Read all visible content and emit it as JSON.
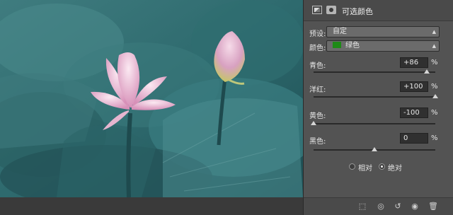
{
  "panel": {
    "title": "可选颜色",
    "preset": {
      "label": "预设:",
      "value": "自定"
    },
    "colors": {
      "label": "颜色:",
      "value": "绿色",
      "swatch": "#1e8a16"
    },
    "sliders": [
      {
        "label": "青色:",
        "value": "+86",
        "unit": "%",
        "fraction": 0.93
      },
      {
        "label": "洋红:",
        "value": "+100",
        "unit": "%",
        "fraction": 1.0
      },
      {
        "label": "黄色:",
        "value": "-100",
        "unit": "%",
        "fraction": 0.0
      },
      {
        "label": "黑色:",
        "value": "0",
        "unit": "%",
        "fraction": 0.5
      }
    ],
    "method": {
      "relative": "相对",
      "absolute": "绝对",
      "selected": "absolute"
    }
  },
  "icons": {
    "header": [
      "adjustment-icon",
      "mask-icon"
    ],
    "footer": [
      "clip-to-layer-icon",
      "view-previous-icon",
      "reset-icon",
      "visibility-eye-icon",
      "trash-icon"
    ]
  }
}
